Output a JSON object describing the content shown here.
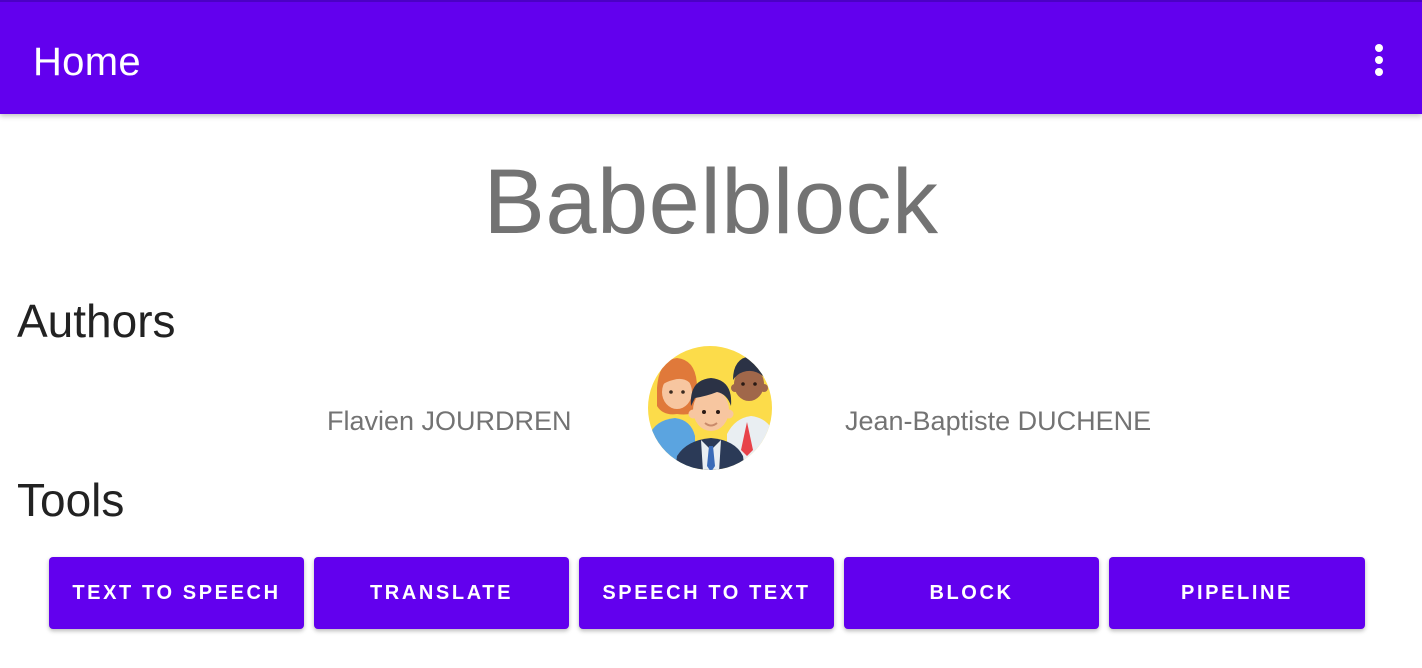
{
  "appbar": {
    "title": "Home",
    "menu_icon": "more-vert-icon",
    "background_color": "#6200EE"
  },
  "main": {
    "app_name": "Babelblock",
    "authors_heading": "Authors",
    "authors": [
      {
        "name": "Flavien JOURDREN"
      },
      {
        "name": "Jean-Baptiste DUCHENE"
      }
    ],
    "authors_image_icon": "team-avatar-icon",
    "tools_heading": "Tools",
    "tools": [
      {
        "label": "TEXT TO SPEECH"
      },
      {
        "label": "TRANSLATE"
      },
      {
        "label": "SPEECH TO TEXT"
      },
      {
        "label": "BLOCK"
      },
      {
        "label": "PIPELINE"
      }
    ]
  }
}
